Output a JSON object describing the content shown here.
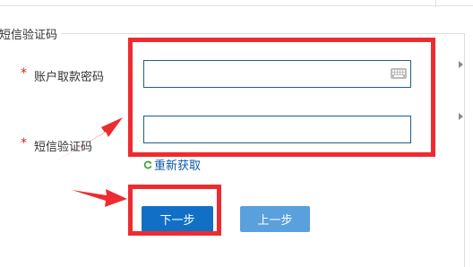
{
  "section": {
    "legend": "短信验证码"
  },
  "fields": {
    "required_mark": "*",
    "withdraw_password_label": "账户取款密码",
    "withdraw_password_value": "",
    "sms_code_label": "短信验证码",
    "sms_code_value": ""
  },
  "resend": {
    "label": "重新获取"
  },
  "buttons": {
    "next_label": "下一步",
    "prev_label": "上一步"
  },
  "icons": {
    "keyboard": "virtual-keyboard-icon",
    "refresh": "refresh-icon",
    "side_arrow": "chevron-right-icon"
  },
  "annotations": {
    "highlight_color": "#ee2b2f"
  }
}
